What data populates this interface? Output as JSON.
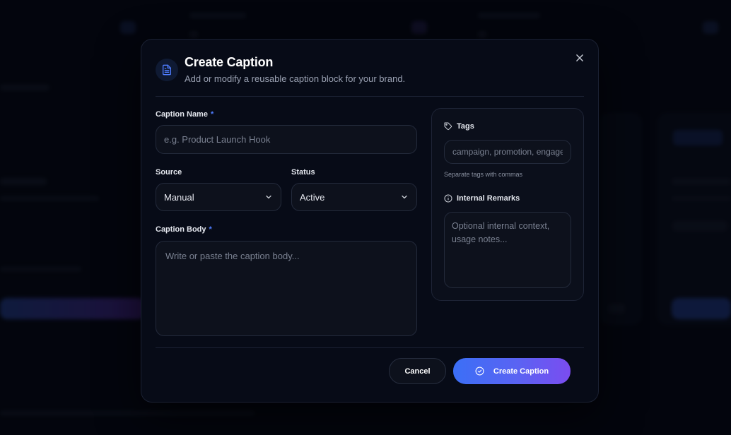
{
  "modal": {
    "title": "Create Caption",
    "subtitle": "Add or modify a reusable caption block for your brand.",
    "header_icon": "document-icon",
    "close_icon": "close-icon"
  },
  "form": {
    "caption_name": {
      "label": "Caption Name",
      "required_mark": "*",
      "placeholder": "e.g. Product Launch Hook",
      "value": ""
    },
    "source": {
      "label": "Source",
      "value": "Manual"
    },
    "status": {
      "label": "Status",
      "value": "Active"
    },
    "caption_body": {
      "label": "Caption Body",
      "required_mark": "*",
      "placeholder": "Write or paste the caption body...",
      "value": ""
    }
  },
  "side": {
    "tags": {
      "label": "Tags",
      "icon": "tag-icon",
      "placeholder": "campaign, promotion, engagement",
      "hint": "Separate tags with commas"
    },
    "remarks": {
      "label": "Internal Remarks",
      "icon": "info-icon",
      "placeholder": "Optional internal context, usage notes..."
    }
  },
  "footer": {
    "cancel_label": "Cancel",
    "create_label": "Create Caption",
    "create_icon": "check-circle-icon"
  },
  "colors": {
    "accent": "#4f7dff",
    "gradient_start": "#3b6ff6",
    "gradient_end": "#7b4cf0",
    "modal_bg": "#070b17"
  }
}
